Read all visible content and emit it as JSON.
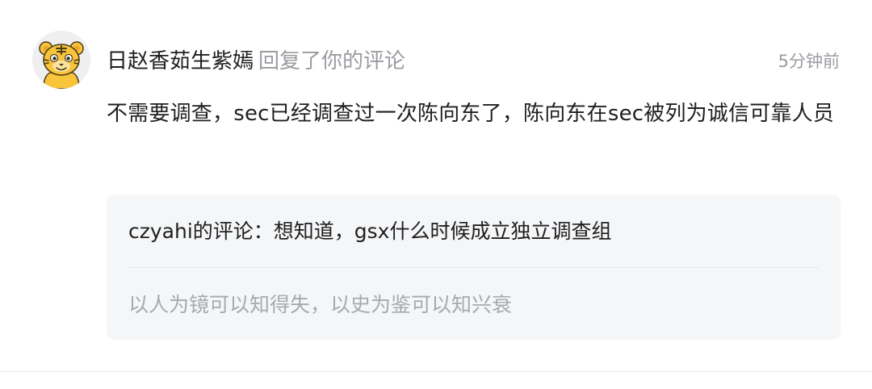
{
  "notification": {
    "avatar_icon": "tiger-avatar-icon",
    "username": "日赵香茹生紫嫣",
    "action": "回复了你的评论",
    "timestamp": "5分钟前",
    "reply_text": "不需要调查，sec已经调查过一次陈向东了，陈向东在sec被列为诚信可靠人员"
  },
  "quote": {
    "my_comment": "czyahi的评论：想知道，gsx什么时候成立独立调查组",
    "original_text": "以人为镜可以知得失，以史为鉴可以知兴衰"
  },
  "colors": {
    "primary_text": "#1f1f1f",
    "secondary_text": "#9b9ba2",
    "quote_background": "#f5f6f8",
    "avatar_yellow": "#f7c43a"
  }
}
